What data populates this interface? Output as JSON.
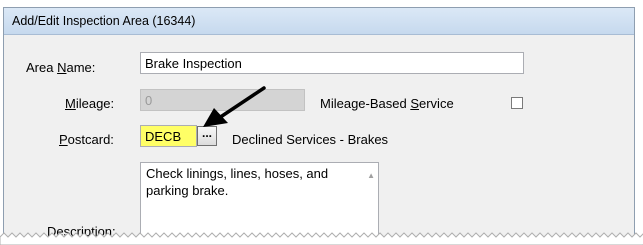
{
  "window": {
    "title": "Add/Edit Inspection Area (16344)"
  },
  "area_name": {
    "label_pre": "Area ",
    "label_key": "N",
    "label_post": "ame:",
    "value": "Brake Inspection"
  },
  "mileage": {
    "label_key": "M",
    "label_post": "ileage:",
    "value": "0"
  },
  "mileage_based": {
    "label_pre": "Mileage-Based ",
    "label_key": "S",
    "label_post": "ervice",
    "checked": false
  },
  "postcard": {
    "label_key": "P",
    "label_post": "ostcard:",
    "value": "DECB",
    "browse_label": "...",
    "description": "Declined Services - Brakes"
  },
  "description": {
    "label_pre": "Descri",
    "label_key": "p",
    "label_post": "tion:",
    "value": "Check linings, lines, hoses, and parking brake."
  },
  "colors": {
    "highlight": "#ffff66",
    "titlebar": "#c6d9ee"
  },
  "icons": [
    "arrow-annotation-icon",
    "scroll-up-arrow-icon"
  ]
}
